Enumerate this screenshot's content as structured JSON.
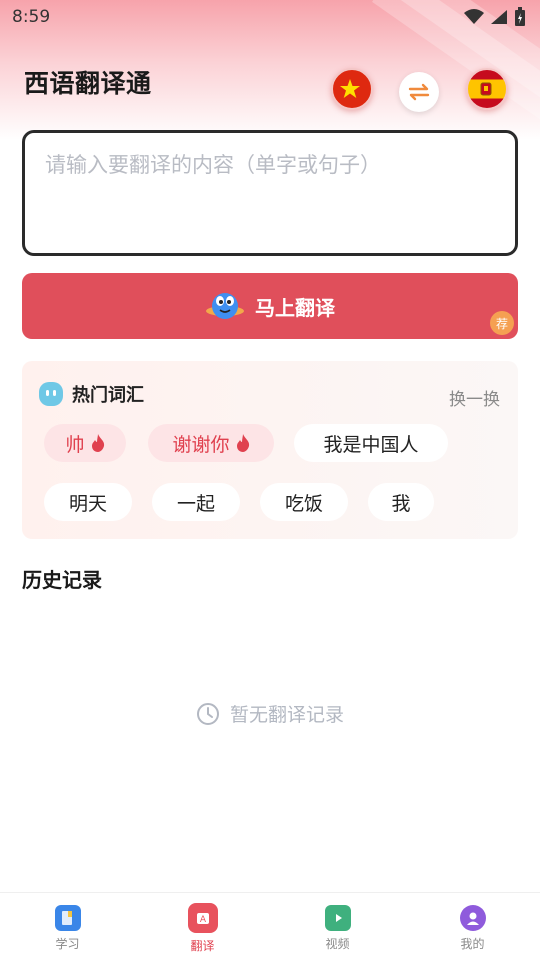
{
  "status": {
    "time": "8:59"
  },
  "header": {
    "title": "西语翻译通"
  },
  "languages": {
    "source": "中文",
    "target": "西班牙语"
  },
  "input": {
    "placeholder": "请输入要翻译的内容（单字或句子）",
    "value": ""
  },
  "translate_button": {
    "label": "马上翻译",
    "badge": "荐"
  },
  "hot_words": {
    "title": "热门词汇",
    "refresh_label": "换一换",
    "items": [
      {
        "text": "帅",
        "hot": true
      },
      {
        "text": "谢谢你",
        "hot": true
      },
      {
        "text": "我是中国人",
        "hot": false
      },
      {
        "text": "明天",
        "hot": false
      },
      {
        "text": "一起",
        "hot": false
      },
      {
        "text": "吃饭",
        "hot": false
      },
      {
        "text": "我",
        "hot": false
      }
    ]
  },
  "history": {
    "title": "历史记录",
    "empty_text": "暂无翻译记录"
  },
  "tabbar": {
    "items": [
      {
        "label": "学习",
        "icon": "book-icon",
        "active": false
      },
      {
        "label": "翻译",
        "icon": "translate-icon",
        "active": true
      },
      {
        "label": "视频",
        "icon": "tv-icon",
        "active": false
      },
      {
        "label": "我的",
        "icon": "profile-icon",
        "active": false
      }
    ]
  },
  "colors": {
    "accent": "#e04f5b",
    "hot_chip_bg": "#fde4e6",
    "hot_text": "#e0414f"
  }
}
